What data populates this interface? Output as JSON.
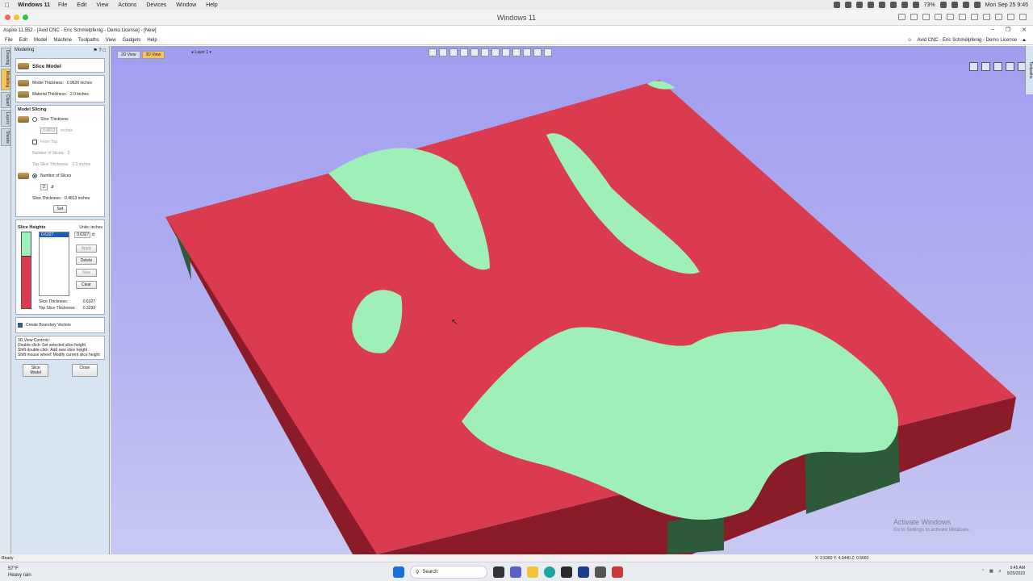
{
  "mac_menu": {
    "app": "Windows 11",
    "items": [
      "File",
      "Edit",
      "View",
      "Actions",
      "Devices",
      "Window",
      "Help"
    ],
    "battery": "73%",
    "clock": "Mon Sep 25  9:45"
  },
  "vm_window": {
    "title": "Windows 11"
  },
  "app": {
    "title": "Aspire 11.552 - [Avid CNC - Eric Schmelpfenig - Demo License] - [New]",
    "menu": [
      "File",
      "Edit",
      "Model",
      "Machine",
      "Toolpaths",
      "View",
      "Gadgets",
      "Help"
    ],
    "license": "Avid CNC - Eric Schmelpfenig - Demo License"
  },
  "side_tabs": [
    "Drawing",
    "Modeling",
    "Clipart",
    "Layers",
    "Sheets"
  ],
  "panel": {
    "header": "Modeling",
    "title": "Slice Model",
    "model_thickness_label": "Model Thickness:",
    "model_thickness_value": "0.9626 inches",
    "material_thickness_label": "Material Thickness:",
    "material_thickness_value": "2.0 inches",
    "slicing_header": "Model Slicing",
    "slice_thickness_option": "Slice Thickness",
    "slice_thickness_value": "0.4813",
    "slice_thickness_unit": "inches",
    "from_top_label": "From Top",
    "num_slices_label": "Number of Slices:",
    "num_slices_value": "2",
    "top_slice_thickness_label": "Top Slice Thickness:",
    "top_slice_thickness_value": "0.0 inches",
    "number_of_slices_option": "Number of Slices",
    "number_of_slices_value": "2",
    "computed_slice_thickness_label": "Slice Thickness:",
    "computed_slice_thickness_value": "0.4813 inches",
    "set_button": "Set",
    "heights_header": "Slice Heights",
    "units_label": "Units: inches",
    "heights_list": [
      "0.6327"
    ],
    "height_field": "0.6327",
    "apply_button": "Apply",
    "delete_button": "Delete",
    "new_button": "New",
    "clear_button": "Clear",
    "result_slice_thickness_label": "Slice Thickness:",
    "result_slice_thickness_value": "0.6327",
    "result_top_thickness_label": "Top Slice Thickness:",
    "result_top_thickness_value": "0.3299",
    "boundary_label": "Create Boundary Vectors",
    "help_lines": [
      "3D View Controls:",
      "Double-click: Set selected slice height",
      "Shift double-click: Add new slice height",
      "Shift mouse wheel: Modify current slice height"
    ],
    "slice_model_button": "Slice Model",
    "close_button": "Close"
  },
  "view": {
    "tab_2d": "2D View",
    "tab_3d": "3D View",
    "layer": "Layer 1 ▾",
    "watermark_title": "Activate Windows",
    "watermark_sub": "Go to Settings to activate Windows.",
    "colors": {
      "slice_red": "#db3b4f",
      "slice_green": "#9ff0b8",
      "side_dark_red": "#8a1c2a",
      "side_dark_green": "#2f5a3a"
    }
  },
  "right_tab": "Toolpaths",
  "status": {
    "ready": "Ready",
    "coords": "X: 2.5360 Y: 4.3440 Z: 0.5660"
  },
  "taskbar": {
    "temp": "57°F",
    "weather": "Heavy rain",
    "search": "Search",
    "time": "9:45 AM",
    "date": "9/25/2023"
  }
}
